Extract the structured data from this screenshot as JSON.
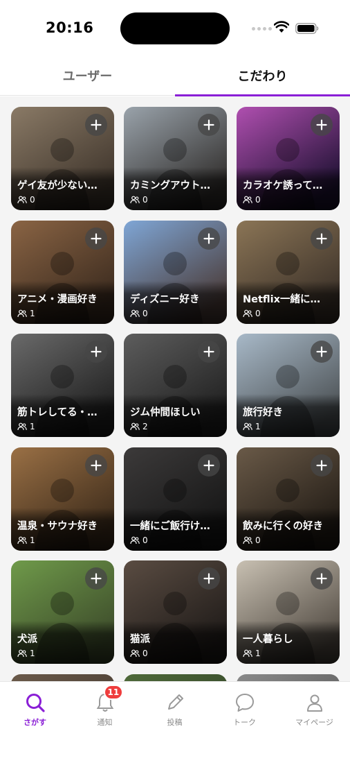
{
  "status_bar": {
    "time": "20:16"
  },
  "tabs": [
    {
      "label": "ユーザー",
      "active": false
    },
    {
      "label": "こだわり",
      "active": true
    }
  ],
  "accent_color": "#8a1fd6",
  "cards": [
    {
      "title": "ゲイ友が少ない…",
      "members": "0",
      "bg": [
        "#8a7a66",
        "#3e342b"
      ]
    },
    {
      "title": "カミングアウト…",
      "members": "0",
      "bg": [
        "#9aa3ab",
        "#2f2c2a"
      ]
    },
    {
      "title": "カラオケ誘って…",
      "members": "0",
      "bg": [
        "#b04fb0",
        "#1b1030"
      ]
    },
    {
      "title": "アニメ・漫画好き",
      "members": "1",
      "bg": [
        "#8a6444",
        "#3a2a1e"
      ]
    },
    {
      "title": "ディズニー好き",
      "members": "0",
      "bg": [
        "#7fa6d6",
        "#4a3a36"
      ]
    },
    {
      "title": "Netflix一緒に…",
      "members": "0",
      "bg": [
        "#8b7556",
        "#3a3028"
      ]
    },
    {
      "title": "筋トレしてる・…",
      "members": "1",
      "bg": [
        "#6a6a6a",
        "#1e1e1e"
      ]
    },
    {
      "title": "ジム仲間ほしい",
      "members": "2",
      "bg": [
        "#5d5d5d",
        "#1f1f1f"
      ]
    },
    {
      "title": "旅行好き",
      "members": "1",
      "bg": [
        "#a8b9c8",
        "#4a4f52"
      ]
    },
    {
      "title": "温泉・サウナ好き",
      "members": "1",
      "bg": [
        "#9a7045",
        "#3b2a1a"
      ]
    },
    {
      "title": "一緒にご飯行け…",
      "members": "0",
      "bg": [
        "#3c3a3a",
        "#151515"
      ]
    },
    {
      "title": "飲みに行くの好き",
      "members": "0",
      "bg": [
        "#6a5a48",
        "#201a14"
      ]
    },
    {
      "title": "犬派",
      "members": "1",
      "bg": [
        "#6f9a4a",
        "#3c4a2a"
      ]
    },
    {
      "title": "猫派",
      "members": "0",
      "bg": [
        "#5a4c42",
        "#1e1a18"
      ]
    },
    {
      "title": "一人暮らし",
      "members": "1",
      "bg": [
        "#c8c0b2",
        "#4f4840"
      ]
    },
    {
      "title": "",
      "members": "",
      "bg": [
        "#6b5a4a",
        "#3a3028"
      ]
    },
    {
      "title": "",
      "members": "",
      "bg": [
        "#4f6a3a",
        "#2a3a22"
      ]
    },
    {
      "title": "",
      "members": "",
      "bg": [
        "#8a8a8a",
        "#4a4a4a"
      ]
    }
  ],
  "bottom_nav": [
    {
      "label": "さがす",
      "icon": "search-icon",
      "active": true
    },
    {
      "label": "通知",
      "icon": "bell-icon",
      "badge": "11"
    },
    {
      "label": "投稿",
      "icon": "pencil-icon"
    },
    {
      "label": "トーク",
      "icon": "chat-bubble-icon"
    },
    {
      "label": "マイページ",
      "icon": "person-icon"
    }
  ]
}
